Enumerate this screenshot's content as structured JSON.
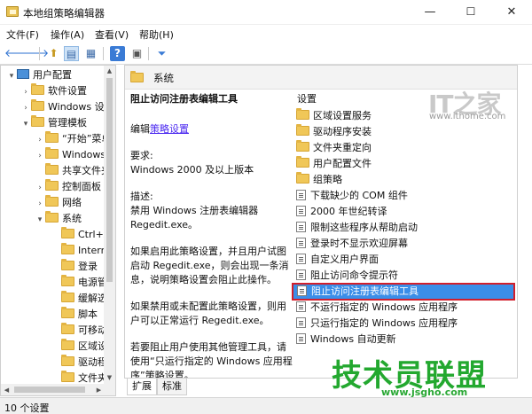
{
  "window": {
    "title": "本地组策略编辑器",
    "controls": {
      "minimize": "—",
      "maximize": "☐",
      "close": "✕"
    }
  },
  "menu": [
    "文件(F)",
    "操作(A)",
    "查看(V)",
    "帮助(H)"
  ],
  "toolbar": {
    "buttons": [
      {
        "name": "back-icon",
        "glyph": "🡐"
      },
      {
        "name": "forward-icon",
        "glyph": "🡒"
      },
      {
        "name": "up-folder-icon",
        "glyph": "⬆"
      },
      {
        "name": "show-tree-icon",
        "glyph": "▤"
      },
      {
        "name": "export-list-icon",
        "glyph": "▦"
      },
      {
        "name": "help-icon",
        "glyph": "?"
      },
      {
        "name": "properties-icon",
        "glyph": "▣"
      },
      {
        "name": "filter-icon",
        "glyph": "⏷"
      }
    ]
  },
  "tree": [
    {
      "label": "用户配置",
      "arrow": "▾",
      "type": "pc"
    },
    {
      "label": "软件设置",
      "arrow": "›",
      "type": "folder"
    },
    {
      "label": "Windows 设置",
      "arrow": "›",
      "type": "folder"
    },
    {
      "label": "管理模板",
      "arrow": "▾",
      "type": "folder"
    },
    {
      "label": "“开始”菜单",
      "arrow": "›",
      "type": "folder"
    },
    {
      "label": "Windows 组件",
      "arrow": "›",
      "type": "folder"
    },
    {
      "label": "共享文件夹",
      "arrow": "",
      "type": "folder"
    },
    {
      "label": "控制面板",
      "arrow": "›",
      "type": "folder"
    },
    {
      "label": "网络",
      "arrow": "›",
      "type": "folder"
    },
    {
      "label": "系统",
      "arrow": "▾",
      "type": "folder"
    },
    {
      "label": "Ctrl+Alt",
      "arrow": "",
      "type": "folder"
    },
    {
      "label": "Internet",
      "arrow": "",
      "type": "folder"
    },
    {
      "label": "登录",
      "arrow": "",
      "type": "folder"
    },
    {
      "label": "电源管理",
      "arrow": "",
      "type": "folder"
    },
    {
      "label": "缓解选项",
      "arrow": "",
      "type": "folder"
    },
    {
      "label": "脚本",
      "arrow": "",
      "type": "folder"
    },
    {
      "label": "可移动存储",
      "arrow": "",
      "type": "folder"
    },
    {
      "label": "区域设置",
      "arrow": "",
      "type": "folder"
    },
    {
      "label": "驱动程序",
      "arrow": "",
      "type": "folder"
    },
    {
      "label": "文件夹",
      "arrow": "",
      "type": "folder"
    }
  ],
  "detail": {
    "header": "系统",
    "column_header": "设置",
    "description": {
      "title": "阻止访问注册表编辑工具",
      "edit_prefix": "编辑",
      "edit_link": "策略设置",
      "requirement_label": "要求:",
      "requirement": "Windows 2000 及以上版本",
      "desc_label": "描述:",
      "desc_lines": [
        "禁用 Windows 注册表编辑器",
        "Regedit.exe。"
      ],
      "enabled_lines": [
        "如果启用此策略设置，并且用户试图",
        "启动 Regedit.exe，则会出现一条消",
        "息，说明策略设置会阻止此操作。"
      ],
      "disabled_lines": [
        "如果禁用或未配置此策略设置，则用",
        "户可以正常运行 Regedit.exe。"
      ],
      "other_lines": [
        "若要阻止用户使用其他管理工具，请",
        "使用“只运行指定的 Windows 应用程",
        "序”策略设置。"
      ]
    },
    "items": [
      {
        "label": "区域设置服务",
        "type": "folder"
      },
      {
        "label": "驱动程序安装",
        "type": "folder"
      },
      {
        "label": "文件夹重定向",
        "type": "folder"
      },
      {
        "label": "用户配置文件",
        "type": "folder"
      },
      {
        "label": "组策略",
        "type": "folder"
      },
      {
        "label": "下载缺少的 COM 组件",
        "type": "policy"
      },
      {
        "label": "2000 年世纪转译",
        "type": "policy"
      },
      {
        "label": "限制这些程序从帮助启动",
        "type": "policy"
      },
      {
        "label": "登录时不显示欢迎屏幕",
        "type": "policy"
      },
      {
        "label": "自定义用户界面",
        "type": "policy"
      },
      {
        "label": "阻止访问命令提示符",
        "type": "policy"
      },
      {
        "label": "阻止访问注册表编辑工具",
        "type": "policy",
        "selected": true
      },
      {
        "label": "不运行指定的 Windows 应用程序",
        "type": "policy"
      },
      {
        "label": "只运行指定的 Windows 应用程序",
        "type": "policy"
      },
      {
        "label": "Windows 自动更新",
        "type": "policy"
      }
    ]
  },
  "tabs": [
    "扩展",
    "标准"
  ],
  "status": "10 个设置",
  "watermarks": {
    "ithome_logo": "IT之家",
    "ithome_url": "www.ithome.com",
    "jsgho_logo": "技术员联盟",
    "jsgho_url": "www.jsgho.com"
  },
  "colors": {
    "selection": "#3b8ee8",
    "highlight_border": "#d21f2c",
    "link": "#4c2af0",
    "folder": "#f0c758",
    "watermark_green": "#23a82f"
  }
}
